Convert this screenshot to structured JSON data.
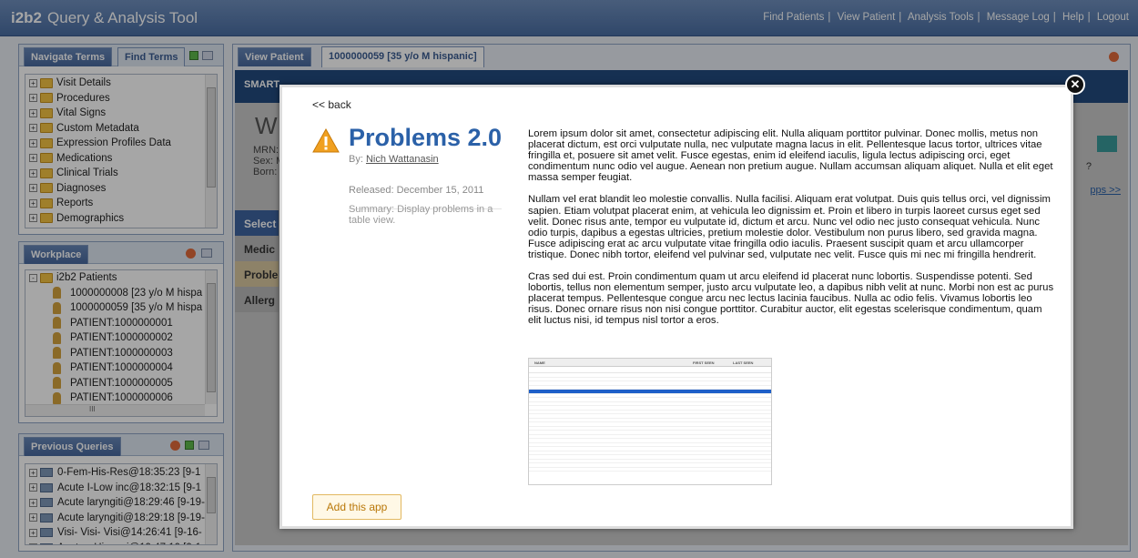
{
  "header": {
    "brand_bold": "i2b2",
    "brand_rest": "Query & Analysis Tool",
    "nav": [
      "Find Patients",
      "View Patient",
      "Analysis Tools",
      "Message Log",
      "Help",
      "Logout"
    ],
    "nav_separator": "|"
  },
  "terms_panel": {
    "tabs": [
      "Navigate Terms",
      "Find Terms"
    ],
    "items": [
      "Visit Details",
      "Procedures",
      "Vital Signs",
      "Custom Metadata",
      "Expression Profiles Data",
      "Medications",
      "Clinical Trials",
      "Diagnoses",
      "Reports",
      "Demographics"
    ],
    "expander": "+"
  },
  "workplace_panel": {
    "title": "Workplace",
    "root": "i2b2 Patients",
    "collapse": "-",
    "items": [
      "1000000008 [23 y/o M hispa",
      "1000000059 [35 y/o M hispa",
      "PATIENT:1000000001",
      "PATIENT:1000000002",
      "PATIENT:1000000003",
      "PATIENT:1000000004",
      "PATIENT:1000000005",
      "PATIENT:1000000006"
    ],
    "hscroll_label": "III"
  },
  "queries_panel": {
    "title": "Previous Queries",
    "items": [
      "0-Fem-His-Res@18:35:23 [9-1",
      "Acute I-Low inc@18:32:15 [9-1",
      "Acute laryngiti@18:29:46 [9-19-",
      "Acute laryngiti@18:29:18 [9-19-",
      "Visi- Visi- Visi@14:26:41 [9-16-",
      "Acute r-Hispani@19:47:10 [9-1"
    ]
  },
  "view_patient": {
    "tabs": [
      "View Patient",
      "1000000059 [35 y/o M hispanic]"
    ],
    "bg_fragments": {
      "smart": "SMART",
      "initial": "W",
      "mrn": "MRN:",
      "sex": "Sex: M",
      "born": "Born:",
      "select": "Select",
      "side_tabs": [
        "Medic",
        "Proble",
        "Allerg"
      ],
      "apps_link": "pps >>",
      "question_mark": "?"
    }
  },
  "modal": {
    "back": "<< back",
    "title": "Problems 2.0",
    "by_label": "By:",
    "author": "Nich Wattanasin",
    "released": "Released: December 15, 2011",
    "summary": "Summary: Display problems in a table view.",
    "paragraphs": [
      "Lorem ipsum dolor sit amet, consectetur adipiscing elit. Nulla aliquam porttitor pulvinar. Donec mollis, metus non placerat dictum, est orci vulputate nulla, nec vulputate magna lacus in elit. Pellentesque lacus tortor, ultrices vitae fringilla et, posuere sit amet velit. Fusce egestas, enim id eleifend iaculis, ligula lectus adipiscing orci, eget condimentum nunc odio vel augue. Aenean non pretium augue. Nullam accumsan aliquam aliquet. Nulla et elit eget massa semper feugiat.",
      "Nullam vel erat blandit leo molestie convallis. Nulla facilisi. Aliquam erat volutpat. Duis quis tellus orci, vel dignissim sapien. Etiam volutpat placerat enim, at vehicula leo dignissim et. Proin et libero in turpis laoreet cursus eget sed velit. Donec risus ante, tempor eu vulputate id, dictum et arcu. Nunc vel odio nec justo consequat vehicula. Nunc odio turpis, dapibus a egestas ultricies, pretium molestie dolor. Vestibulum non purus libero, sed gravida magna. Fusce adipiscing erat ac arcu vulputate vitae fringilla odio iaculis. Praesent suscipit quam et arcu ullamcorper tristique. Donec nibh tortor, eleifend vel pulvinar sed, vulputate nec velit. Fusce quis mi nec mi fringilla hendrerit.",
      "Cras sed dui est. Proin condimentum quam ut arcu eleifend id placerat nunc lobortis. Suspendisse potenti. Sed lobortis, tellus non elementum semper, justo arcu vulputate leo, a dapibus nibh velit at nunc. Morbi non est ac purus placerat tempus. Pellentesque congue arcu nec lectus lacinia faucibus. Nulla ac odio felis. Vivamus lobortis leo risus. Donec ornare risus non nisi congue porttitor. Curabitur auctor, elit egestas scelerisque condimentum, quam elit luctus nisi, id tempus nisl tortor a eros."
    ],
    "preview_headers": [
      "NAME",
      "FIRST SEEN",
      "LAST SEEN"
    ],
    "add_button": "Add this app",
    "close_symbol": "✕"
  }
}
